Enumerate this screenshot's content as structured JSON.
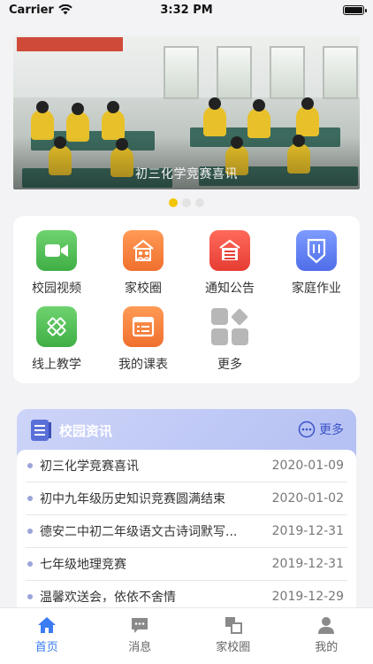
{
  "status_bar": {
    "carrier": "Carrier",
    "time": "3:32 PM"
  },
  "banner": {
    "caption": "初三化学竞赛喜讯",
    "dots": 3,
    "active_dot": 1
  },
  "grid": {
    "items": [
      {
        "label": "校园视频",
        "icon": "video-icon",
        "color": "#4caf50"
      },
      {
        "label": "家校圈",
        "icon": "home-circle-icon",
        "color": "#f07a3a"
      },
      {
        "label": "通知公告",
        "icon": "notice-icon",
        "color": "#ef4a3c"
      },
      {
        "label": "家庭作业",
        "icon": "homework-icon",
        "color": "#5b7cf0"
      },
      {
        "label": "线上教学",
        "icon": "pencil-ruler-icon",
        "color": "#4caf50"
      },
      {
        "label": "我的课表",
        "icon": "timetable-icon",
        "color": "#f07a3a"
      },
      {
        "label": "更多",
        "icon": "more-icon",
        "color": "#b8b8b8"
      }
    ]
  },
  "news": {
    "title": "校园资讯",
    "more_label": "更多",
    "items": [
      {
        "text": "初三化学竞赛喜讯",
        "date": "2020-01-09"
      },
      {
        "text": "初中九年级历史知识竞赛圆满结束",
        "date": "2020-01-02"
      },
      {
        "text": "德安二中初二年级语文古诗词默写...",
        "date": "2019-12-31"
      },
      {
        "text": "七年级地理竞赛",
        "date": "2019-12-31"
      },
      {
        "text": "温馨欢送会，依依不舍情",
        "date": "2019-12-29"
      }
    ]
  },
  "tab_bar": {
    "active": 0,
    "tabs": [
      {
        "label": "首页",
        "icon": "home-icon"
      },
      {
        "label": "消息",
        "icon": "message-icon"
      },
      {
        "label": "家校圈",
        "icon": "circle-icon"
      },
      {
        "label": "我的",
        "icon": "profile-icon"
      }
    ]
  },
  "colors": {
    "accent": "#3b7cf2",
    "dot_active": "#f2c500",
    "news_header": "#b8c3f4"
  }
}
